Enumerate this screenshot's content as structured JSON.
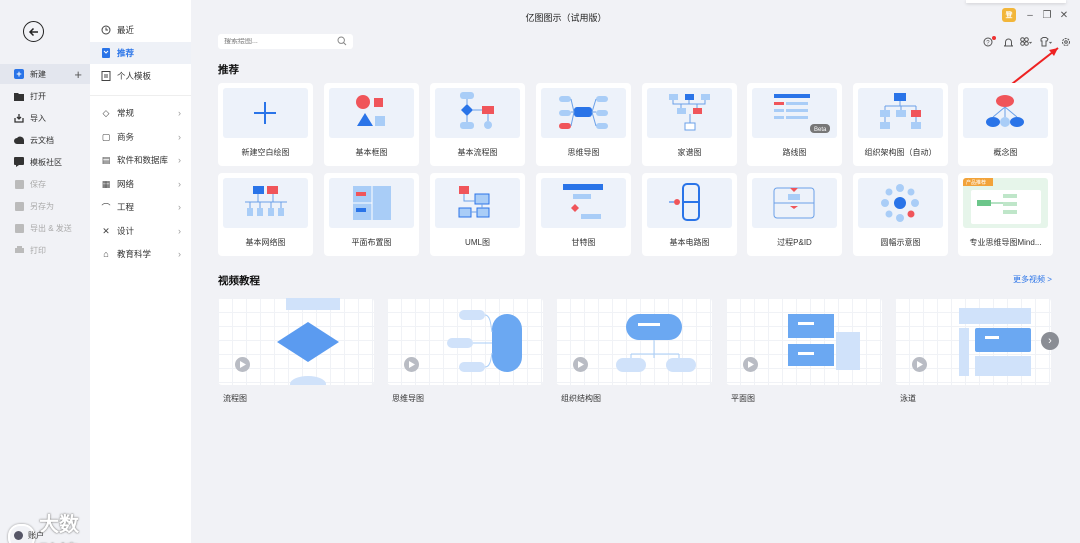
{
  "window": {
    "title": "亿图图示（试用版）",
    "badge": "登"
  },
  "rail": {
    "items": [
      {
        "label": "新建",
        "icon": "new-icon",
        "enabled": true
      },
      {
        "label": "打开",
        "icon": "folder-icon",
        "enabled": true
      },
      {
        "label": "导入",
        "icon": "import-icon",
        "enabled": true
      },
      {
        "label": "云文档",
        "icon": "cloud-icon",
        "enabled": true
      },
      {
        "label": "模板社区",
        "icon": "community-icon",
        "enabled": true
      },
      {
        "label": "保存",
        "icon": "save-icon",
        "enabled": false
      },
      {
        "label": "另存为",
        "icon": "save-as-icon",
        "enabled": false
      },
      {
        "label": "导出 & 发送",
        "icon": "export-icon",
        "enabled": false
      },
      {
        "label": "打印",
        "icon": "print-icon",
        "enabled": false
      }
    ],
    "account_label": "账户"
  },
  "categories": {
    "top": [
      {
        "label": "最近",
        "icon": "clock-icon"
      },
      {
        "label": "推荐",
        "icon": "bookmark-icon",
        "active": true
      },
      {
        "label": "个人模板",
        "icon": "template-icon"
      }
    ],
    "groups": [
      {
        "label": "常规",
        "icon": "tag-icon"
      },
      {
        "label": "商务",
        "icon": "briefcase-icon"
      },
      {
        "label": "软件和数据库",
        "icon": "software-icon"
      },
      {
        "label": "网络",
        "icon": "network-icon"
      },
      {
        "label": "工程",
        "icon": "helmet-icon"
      },
      {
        "label": "设计",
        "icon": "design-icon"
      },
      {
        "label": "教育科学",
        "icon": "education-icon"
      }
    ]
  },
  "search": {
    "placeholder": "搜索绘图..."
  },
  "sections": {
    "recommended_title": "推荐",
    "videos_title": "视频教程",
    "more_videos": "更多视频 >"
  },
  "templates": [
    "新建空白绘图",
    "基本框图",
    "基本流程图",
    "思维导图",
    "家谱图",
    "路线图",
    "组织架构图（自动）",
    "概念图",
    "基本网络图",
    "平面布置图",
    "UML图",
    "甘特图",
    "基本电路图",
    "过程P&ID",
    "圆幅示意图",
    "专业思维导图Mind..."
  ],
  "template_tags": {
    "roadmap_beta": "Beta",
    "mind_pro": "产品推荐"
  },
  "videos": [
    "流程图",
    "思维导图",
    "组织结构图",
    "平面图",
    "泳道"
  ],
  "colors": {
    "accent": "#2a74e8",
    "red": "#f0555a",
    "light_blue": "#a9cdf7"
  }
}
